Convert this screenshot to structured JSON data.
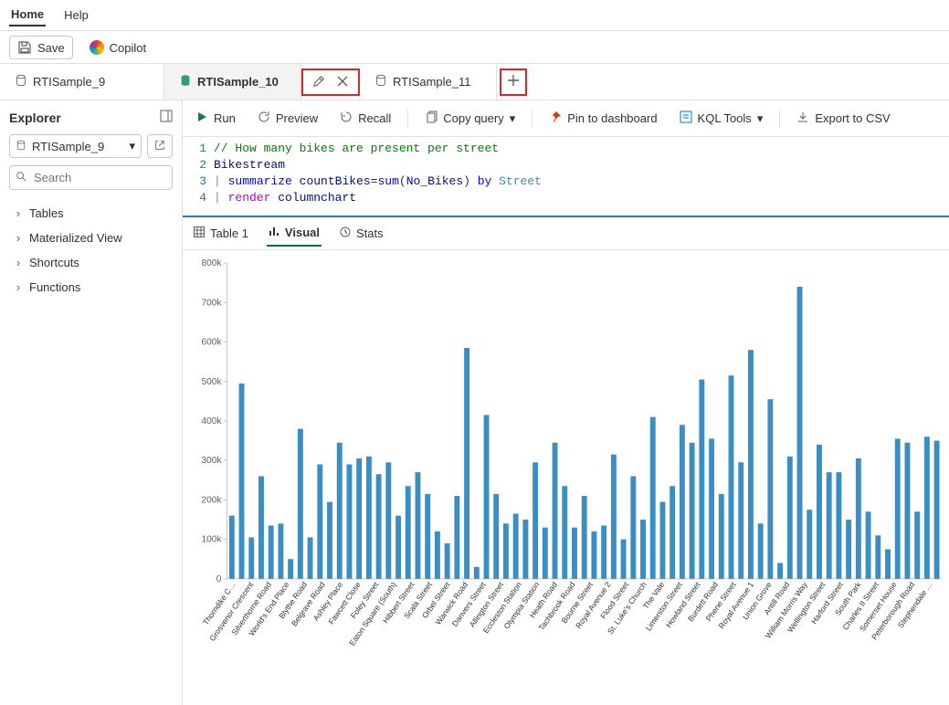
{
  "menubar": {
    "home": "Home",
    "help": "Help"
  },
  "toolbar": {
    "save": "Save",
    "copilot": "Copilot"
  },
  "tabs": [
    {
      "label": "RTISample_9",
      "active": false,
      "icon": "db"
    },
    {
      "label": "RTISample_10",
      "active": true,
      "icon": "db-green"
    },
    {
      "label": "RTISample_11",
      "active": false,
      "icon": "db"
    }
  ],
  "tab_actions": {
    "rename": "rename",
    "close": "close",
    "add": "add"
  },
  "explorer": {
    "title": "Explorer",
    "db_selected": "RTISample_9",
    "search_placeholder": "Search",
    "tree": [
      "Tables",
      "Materialized View",
      "Shortcuts",
      "Functions"
    ]
  },
  "query_toolbar": {
    "run": "Run",
    "preview": "Preview",
    "recall": "Recall",
    "copy": "Copy query",
    "pin": "Pin to dashboard",
    "tools": "KQL Tools",
    "export": "Export to CSV"
  },
  "editor": {
    "lines": [
      {
        "n": "1",
        "tokens": [
          {
            "t": "// How many bikes are present per street",
            "c": "tok-comment"
          }
        ]
      },
      {
        "n": "2",
        "tokens": [
          {
            "t": "Bikestream",
            "c": "tok-obj"
          }
        ]
      },
      {
        "n": "3",
        "tokens": [
          {
            "t": "| ",
            "c": "tok-pipe"
          },
          {
            "t": "summarize",
            "c": "tok-kw"
          },
          {
            "t": " "
          },
          {
            "t": "countBikes",
            "c": "tok-obj"
          },
          {
            "t": "="
          },
          {
            "t": "sum",
            "c": "tok-func"
          },
          {
            "t": "("
          },
          {
            "t": "No_Bikes",
            "c": "tok-obj"
          },
          {
            "t": ") "
          },
          {
            "t": "by",
            "c": "tok-kw"
          },
          {
            "t": " "
          },
          {
            "t": "Street",
            "c": "tok-col"
          }
        ]
      },
      {
        "n": "4",
        "tokens": [
          {
            "t": "| ",
            "c": "tok-pipe"
          },
          {
            "t": "render",
            "c": "tok-render"
          },
          {
            "t": " "
          },
          {
            "t": "columnchart",
            "c": "tok-obj"
          }
        ]
      }
    ]
  },
  "result_tabs": {
    "table": "Table 1",
    "visual": "Visual",
    "stats": "Stats"
  },
  "chart_data": {
    "type": "bar",
    "title": "",
    "xlabel": "",
    "ylabel": "",
    "ylim": [
      0,
      800000
    ],
    "yticks": [
      0,
      100000,
      200000,
      300000,
      400000,
      500000,
      600000,
      700000,
      800000
    ],
    "ytick_labels": [
      "0",
      "100k",
      "200k",
      "300k",
      "400k",
      "500k",
      "600k",
      "700k",
      "800k"
    ],
    "categories": [
      "Thorndike C…",
      "Grosvenor Crescent",
      "Silverthorne Road",
      "World's End Place",
      "Blythe Road",
      "Belgrave Road",
      "Ashley Place",
      "Fawcett Close",
      "Foley Street",
      "Eaton Square (South)",
      "Hibbert Street",
      "Scala Street",
      "Orbel Street",
      "Warwick Road",
      "Danvers Street",
      "Allington Street",
      "Eccleston Station",
      "Olympia Station",
      "Heath Road",
      "Tachbrook Road",
      "Bourne Street",
      "Royal Avenue 2",
      "Flood Street",
      "St. Luke's Church",
      "The Vale",
      "Limerston Street",
      "Howland Street",
      "Burdett Road",
      "Phene Street",
      "Royal Avenue 1",
      "Union Grove",
      "Antill Road",
      "William Morris Way",
      "Wellington Street",
      "Harford Street",
      "South Park",
      "Charles II Street",
      "Somerset House",
      "Peterborough Road",
      "Stephendale …"
    ],
    "values": [
      160000,
      495000,
      105000,
      260000,
      135000,
      140000,
      50000,
      380000,
      105000,
      290000,
      195000,
      345000,
      290000,
      305000,
      310000,
      265000,
      295000,
      160000,
      235000,
      270000,
      215000,
      120000,
      90000,
      210000,
      585000,
      30000,
      415000,
      215000,
      140000,
      165000,
      150000,
      295000,
      130000,
      345000,
      235000,
      130000,
      210000,
      120000,
      135000,
      315000,
      100000,
      260000,
      150000,
      410000,
      195000,
      235000,
      390000,
      345000,
      505000,
      355000,
      215000,
      515000,
      295000,
      580000,
      140000,
      455000,
      40000,
      310000,
      740000,
      175000,
      340000,
      270000,
      270000,
      150000,
      305000,
      170000,
      110000,
      75000,
      355000,
      345000,
      170000,
      360000,
      350000
    ]
  }
}
